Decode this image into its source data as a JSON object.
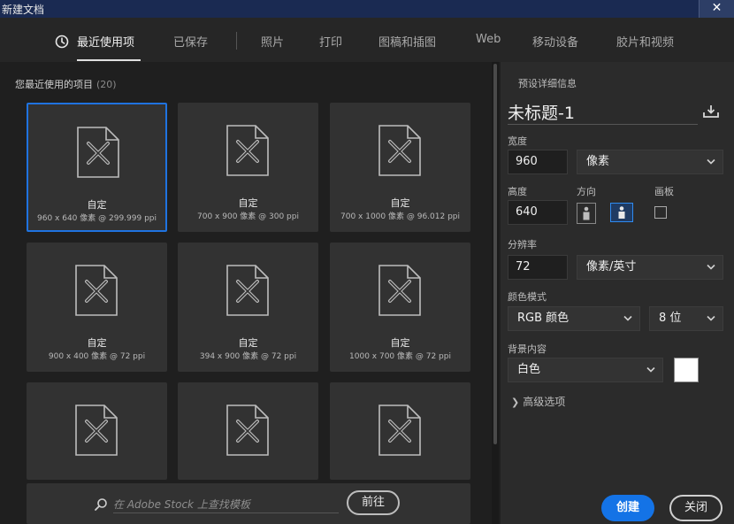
{
  "window": {
    "title": "新建文档",
    "close_glyph": "✕"
  },
  "tabs": [
    {
      "label": "最近使用项",
      "icon": "clock-icon",
      "active": true
    },
    {
      "label": "已保存"
    },
    {
      "label": "照片"
    },
    {
      "label": "打印"
    },
    {
      "label": "图稿和插图"
    },
    {
      "label": "Web"
    },
    {
      "label": "移动设备"
    },
    {
      "label": "胶片和视频"
    }
  ],
  "recent": {
    "title": "您最近使用的项目",
    "count": "(20)",
    "items": [
      {
        "name": "自定",
        "meta": "960 x 640 像素 @ 299.999 ppi",
        "selected": true
      },
      {
        "name": "自定",
        "meta": "700 x 900 像素 @ 300 ppi"
      },
      {
        "name": "自定",
        "meta": "700 x 1000 像素 @ 96.012 ppi"
      },
      {
        "name": "自定",
        "meta": "900 x 400 像素 @ 72 ppi"
      },
      {
        "name": "自定",
        "meta": "394 x 900 像素 @ 72 ppi"
      },
      {
        "name": "自定",
        "meta": "1000 x 700 像素 @ 72 ppi"
      },
      {
        "name": "",
        "meta": ""
      },
      {
        "name": "",
        "meta": ""
      },
      {
        "name": "",
        "meta": ""
      }
    ]
  },
  "stock_search": {
    "placeholder": "在 Adobe Stock 上查找模板",
    "go_label": "前往"
  },
  "preset": {
    "section_title": "预设详细信息",
    "doc_name": "未标题-1",
    "width_label": "宽度",
    "width_value": "960",
    "width_unit": "像素",
    "height_label": "高度",
    "height_value": "640",
    "orientation_label": "方向",
    "artboard_label": "画板",
    "resolution_label": "分辨率",
    "resolution_value": "72",
    "resolution_unit": "像素/英寸",
    "color_mode_label": "颜色模式",
    "color_mode_value": "RGB 颜色",
    "bit_depth_value": "8 位",
    "background_label": "背景内容",
    "background_value": "白色",
    "background_color": "#ffffff",
    "advanced_label": "高级选项",
    "create_label": "创建",
    "close_label": "关闭"
  },
  "colors": {
    "accent": "#1473e6",
    "selected_border": "#1f73e0"
  }
}
